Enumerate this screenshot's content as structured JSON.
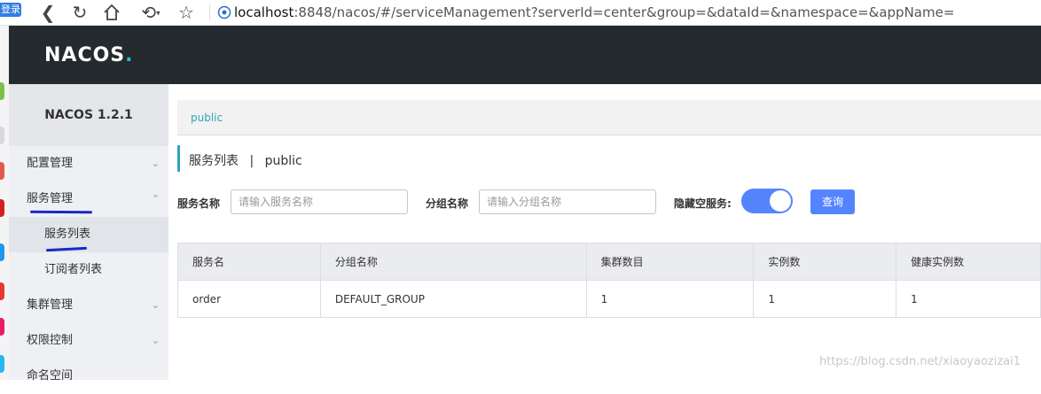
{
  "browser": {
    "extension_badge": "登录",
    "address_host": "localhost",
    "address_rest": ":8848/nacos/#/serviceManagement?serverId=center&group=&dataId=&namespace=&appName="
  },
  "header": {
    "logo_main": "NACOS",
    "logo_dot": "."
  },
  "sidebar": {
    "version": "NACOS 1.2.1",
    "items": [
      {
        "label": "配置管理"
      },
      {
        "label": "服务管理"
      },
      {
        "label": "服务列表"
      },
      {
        "label": "订阅者列表"
      },
      {
        "label": "集群管理"
      },
      {
        "label": "权限控制"
      },
      {
        "label": "命名空间"
      }
    ]
  },
  "breadcrumb": {
    "namespace": "public"
  },
  "page": {
    "title": "服务列表",
    "separator": "|",
    "namespace": "public"
  },
  "filters": {
    "service_label": "服务名称",
    "service_placeholder": "请输入服务名称",
    "group_label": "分组名称",
    "group_placeholder": "请输入分组名称",
    "hide_empty_label": "隐藏空服务:",
    "hide_empty_on": true,
    "query_button": "查询"
  },
  "table": {
    "headers": [
      "服务名",
      "分组名称",
      "集群数目",
      "实例数",
      "健康实例数"
    ],
    "rows": [
      [
        "order",
        "DEFAULT_GROUP",
        "1",
        "1",
        "1"
      ]
    ]
  },
  "watermark": "https://blog.csdn.net/xiaoyaozizai1",
  "colors": {
    "accent": "#5584ff",
    "header_bg": "#252a2f",
    "teal": "#2fa3bf",
    "annotation_ink": "#1a27c9"
  }
}
